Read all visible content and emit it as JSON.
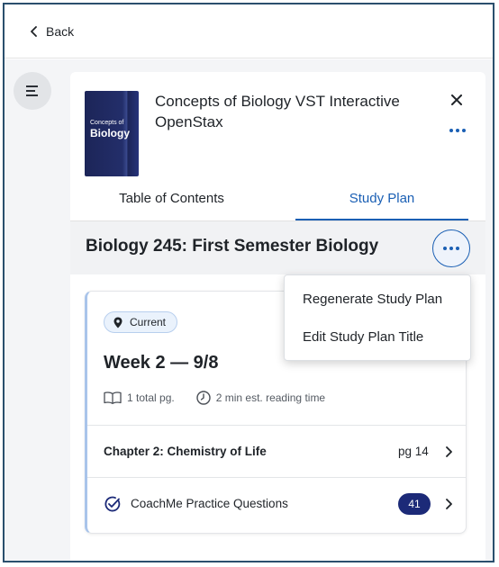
{
  "topbar": {
    "back_label": "Back"
  },
  "book": {
    "cover_line1": "Concepts of",
    "cover_line2": "Biology",
    "title": "Concepts of Biology VST Interactive OpenStax"
  },
  "tabs": [
    {
      "label": "Table of Contents",
      "active": false
    },
    {
      "label": "Study Plan",
      "active": true
    }
  ],
  "plan": {
    "title": "Biology 245: First Semester Biology"
  },
  "menu": {
    "items": [
      {
        "label": "Regenerate Study Plan"
      },
      {
        "label": "Edit Study Plan Title"
      }
    ]
  },
  "week": {
    "badge": "Current",
    "title": "Week 2 — 9/8",
    "pages": "1 total pg.",
    "reading_time": "2 min est. reading time",
    "chapter_label": "Chapter 2: Chemistry of Life",
    "chapter_page": "pg 14",
    "coach_label": "CoachMe Practice Questions",
    "coach_count": "41"
  },
  "colors": {
    "accent": "#1a5fb4",
    "frame": "#2a4f6d",
    "badge_dark": "#1c2a78",
    "cover": "#1c2558"
  },
  "icons": {
    "back": "chevron-left-icon",
    "menu": "hamburger-icon",
    "close": "close-icon",
    "more": "ellipsis-icon",
    "location": "location-pin-icon",
    "book": "open-book-icon",
    "clock": "clock-icon",
    "chevron": "chevron-right-icon",
    "coach": "checkmark-circle-icon"
  }
}
